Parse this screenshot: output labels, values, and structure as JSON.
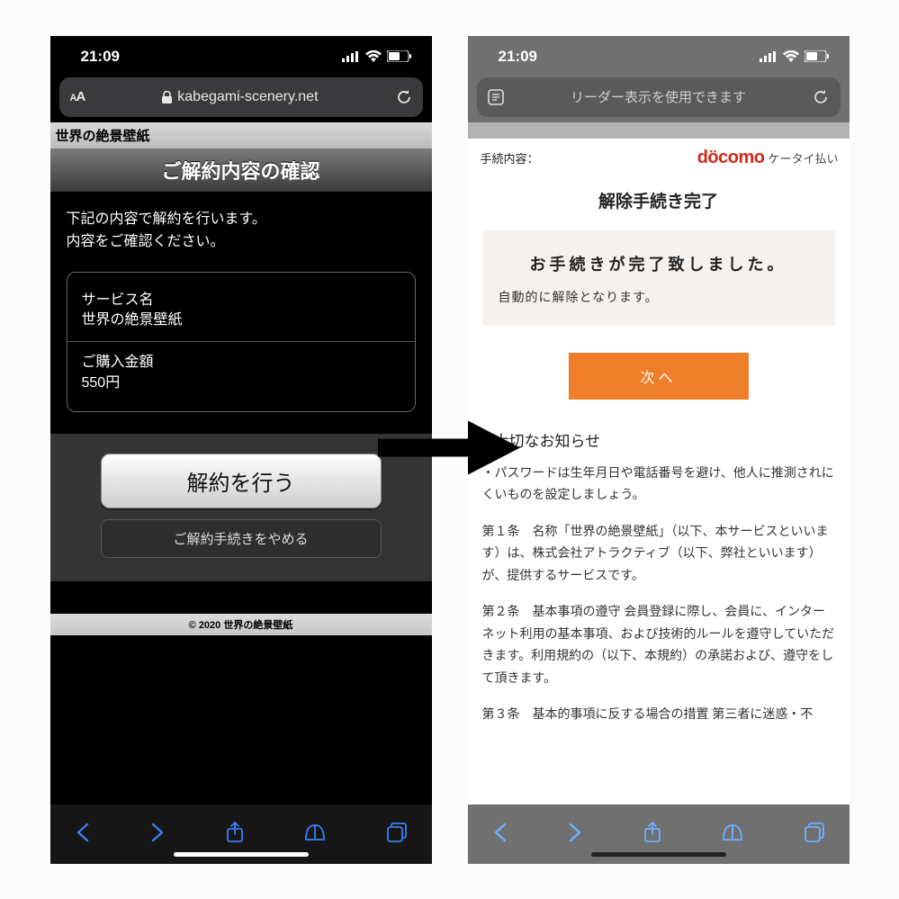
{
  "status": {
    "time": "21:09"
  },
  "left": {
    "url": "kabegami-scenery.net",
    "site_title": "世界の絶景壁紙",
    "header": "ご解約内容の確認",
    "confirm_line1": "下記の内容で解約を行います。",
    "confirm_line2": "内容をご確認ください。",
    "service_label": "サービス名",
    "service_name": "世界の絶景壁紙",
    "price_label": "ご購入金額",
    "price_value": "550円",
    "btn_primary": "解約を行う",
    "btn_secondary": "ご解約手続きをやめる",
    "copyright": "© 2020 世界の絶景壁紙"
  },
  "right": {
    "urlbar_text": "リーダー表示を使用できます",
    "meta_label": "手続内容：",
    "brand": "döcomo",
    "brand_sub": "ケータイ払い",
    "comp_header": "解除手続き完了",
    "comp_title": "お手続きが完了致しました。",
    "comp_sub": "自動的に解除となります。",
    "next": "次へ",
    "notice_head": "大切なお知らせ",
    "notice_p1": "・パスワードは生年月日や電話番号を避け、他人に推測されにくいものを設定しましょう。",
    "notice_p2": "第１条　名称「世界の絶景壁紙」（以下、本サービスといいます）は、株式会社アトラクティブ（以下、弊社といいます）が、提供するサービスです。",
    "notice_p3": "第２条　基本事項の遵守 会員登録に際し、会員に、インターネット利用の基本事項、および技術的ルールを遵守していただきます。利用規約の（以下、本規約）の承諾および、遵守をして頂きます。",
    "notice_p4": "第３条　基本的事項に反する場合の措置 第三者に迷惑・不"
  }
}
